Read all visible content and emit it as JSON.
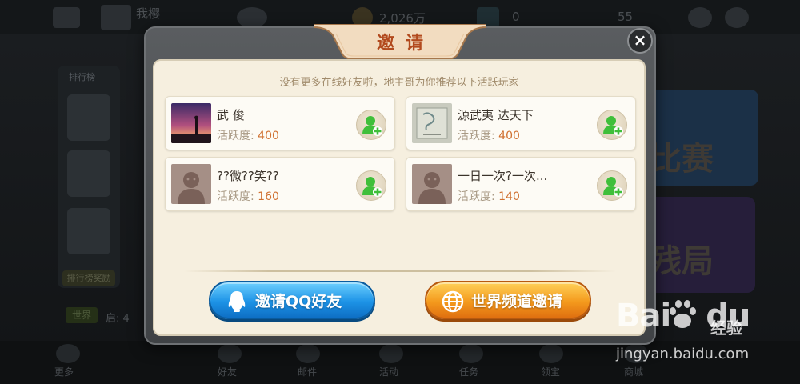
{
  "background": {
    "top_bar": {
      "profile_name": "我樱",
      "coins": "2,026万",
      "diamonds": "0",
      "level": "55"
    },
    "left_column": {
      "title": "排行榜",
      "footer": "排行榜奖励"
    },
    "right_panels": [
      "比赛",
      "残局"
    ],
    "chat": {
      "tag": "世界",
      "text": "启: 4"
    },
    "bottom_nav": [
      "更多",
      "好友",
      "邮件",
      "活动",
      "任务",
      "领宝",
      "商城"
    ]
  },
  "dialog": {
    "title": "邀请",
    "close_label": "×",
    "subtitle": "没有更多在线好友啦，地主哥为你推荐以下活跃玩家",
    "activity_label": "活跃度:",
    "players": [
      {
        "name": "武 俊",
        "activity": "400",
        "avatar": "sunset-photo"
      },
      {
        "name": "源武夷 达天下",
        "activity": "400",
        "avatar": "certificate-photo"
      },
      {
        "name": "??微??笑??",
        "activity": "160",
        "avatar": "default-avatar"
      },
      {
        "name": "一日一次?一次...",
        "activity": "140",
        "avatar": "default-avatar"
      }
    ],
    "buttons": {
      "invite_qq": "邀请QQ好友",
      "world_channel": "世界频道邀请"
    }
  },
  "watermark": {
    "logo": "Bai",
    "logo_du": "du",
    "chinese": "经验",
    "url": "jingyan.baidu.com"
  }
}
